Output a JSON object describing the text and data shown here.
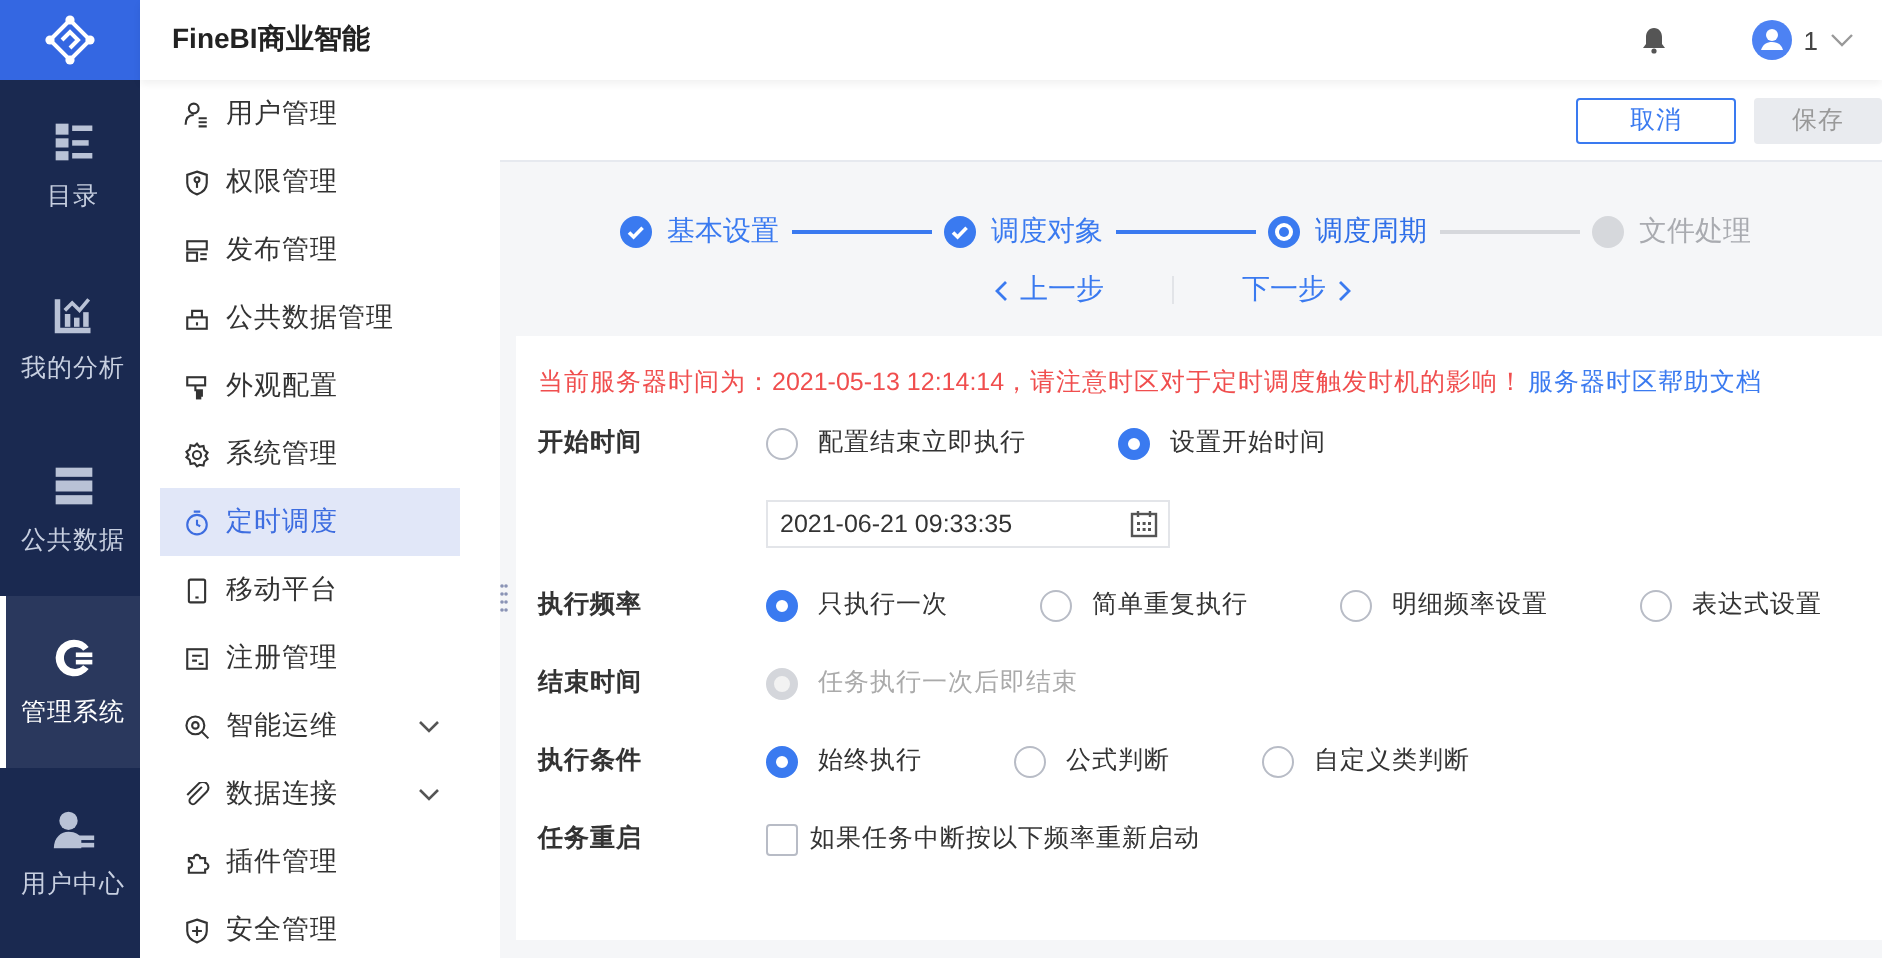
{
  "header": {
    "brand": "FineBI商业智能",
    "user": "1"
  },
  "rail": [
    {
      "label": "目录",
      "selected": false
    },
    {
      "label": "我的分析",
      "selected": false
    },
    {
      "label": "公共数据",
      "selected": false
    },
    {
      "label": "管理系统",
      "selected": true
    },
    {
      "label": "用户中心",
      "selected": false
    }
  ],
  "sidebar": {
    "items": [
      {
        "label": "用户管理",
        "selected": false
      },
      {
        "label": "权限管理",
        "selected": false
      },
      {
        "label": "发布管理",
        "selected": false
      },
      {
        "label": "公共数据管理",
        "selected": false
      },
      {
        "label": "外观配置",
        "selected": false
      },
      {
        "label": "系统管理",
        "selected": false
      },
      {
        "label": "定时调度",
        "selected": true
      },
      {
        "label": "移动平台",
        "selected": false
      },
      {
        "label": "注册管理",
        "selected": false
      },
      {
        "label": "智能运维",
        "selected": false,
        "expanded": false
      },
      {
        "label": "数据连接",
        "selected": false,
        "expanded": false
      },
      {
        "label": "插件管理",
        "selected": false
      },
      {
        "label": "安全管理",
        "selected": false
      }
    ]
  },
  "toolbar": {
    "buttons": [
      {
        "label": "取消",
        "disabled": false
      },
      {
        "label": "保存",
        "disabled": true
      }
    ]
  },
  "steps": [
    {
      "label": "基本设置",
      "done": true,
      "selected": false
    },
    {
      "label": "调度对象",
      "done": true,
      "selected": false
    },
    {
      "label": "调度周期",
      "done": false,
      "selected": true
    },
    {
      "label": "文件处理",
      "done": false,
      "selected": false
    }
  ],
  "step_nav": {
    "prev": "上一步",
    "next": "下一步"
  },
  "notice": {
    "text": "当前服务器时间为：2021-05-13 12:14:14，请注意时区对于定时调度触发时机的影响！",
    "link": "服务器时区帮助文档"
  },
  "form": [
    {
      "kind": "radio",
      "label": "开始时间",
      "options": [
        {
          "label": "配置结束立即执行",
          "selected": false,
          "disabled": false
        },
        {
          "label": "设置开始时间",
          "selected": true,
          "disabled": false
        }
      ]
    },
    {
      "kind": "date",
      "value": "2021-06-21 09:33:35"
    },
    {
      "kind": "radio",
      "label": "执行频率",
      "options": [
        {
          "label": "只执行一次",
          "selected": true,
          "disabled": false
        },
        {
          "label": "简单重复执行",
          "selected": false,
          "disabled": false
        },
        {
          "label": "明细频率设置",
          "selected": false,
          "disabled": false
        },
        {
          "label": "表达式设置",
          "selected": false,
          "disabled": false
        }
      ]
    },
    {
      "kind": "radio",
      "label": "结束时间",
      "options": [
        {
          "label": "任务执行一次后即结束",
          "selected": true,
          "disabled": true
        }
      ]
    },
    {
      "kind": "radio",
      "label": "执行条件",
      "options": [
        {
          "label": "始终执行",
          "selected": true,
          "disabled": false
        },
        {
          "label": "公式判断",
          "selected": false,
          "disabled": false
        },
        {
          "label": "自定义类判断",
          "selected": false,
          "disabled": false
        }
      ]
    },
    {
      "kind": "checkbox",
      "label": "任务重启",
      "option": {
        "label": "如果任务中断按以下频率重新启动",
        "checked": false
      }
    }
  ]
}
